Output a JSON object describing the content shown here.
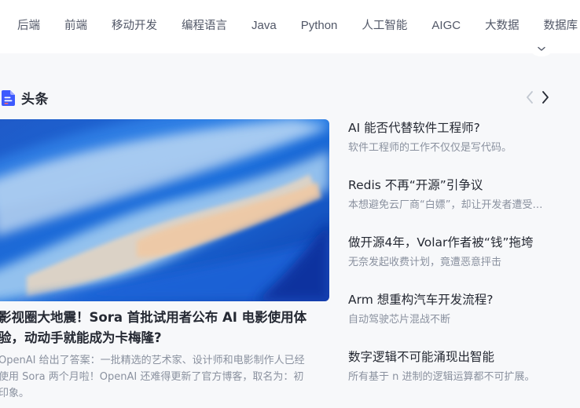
{
  "nav": {
    "items": [
      "后端",
      "前端",
      "移动开发",
      "编程语言",
      "Java",
      "Python",
      "人工智能",
      "AIGC",
      "大数据",
      "数据库"
    ]
  },
  "section": {
    "title": "头条",
    "icon": "document-icon"
  },
  "hero": {
    "title_line1": "影视圈大地震！Sora 首批试用者公布 AI 电影使用体",
    "title_line2": "验，动动手就能成为卡梅隆?",
    "desc_line1": "OpenAI 给出了答案：一批精选的艺术家、设计师和电影制作人已经",
    "desc_line2": "使用 Sora 两个月啦！OpenAI 还难得更新了官方博客，取名为：初",
    "desc_line3": "印象。"
  },
  "headlines": [
    {
      "title": "AI 能否代替软件工程师?",
      "desc": "软件工程师的工作不仅仅是写代码。"
    },
    {
      "title": "Redis 不再“开源”引争议",
      "desc": "本想避免云厂商“白嫖”，却让开发者遭受损失"
    },
    {
      "title": "做开源4年，Volar作者被“钱”拖垮",
      "desc": "无奈发起收费计划，竟遭恶意抨击"
    },
    {
      "title": "Arm 想重构汽车开发流程?",
      "desc": "自动驾驶芯片混战不断"
    },
    {
      "title": "数字逻辑不可能涌现出智能",
      "desc": "所有基于 n 进制的逻辑运算都不可扩展。"
    }
  ],
  "colors": {
    "accent": "#1e80ff",
    "text_primary": "#252933",
    "text_secondary": "#8a919f",
    "nav_text": "#515767"
  }
}
